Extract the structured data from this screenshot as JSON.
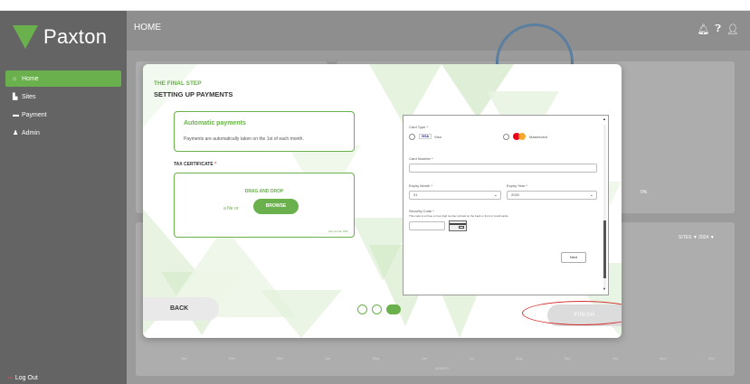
{
  "app": {
    "logo_text": "Paxton",
    "header_title": "HOME"
  },
  "sidebar": {
    "items": [
      {
        "label": "Home",
        "icon": "home-icon",
        "active": true
      },
      {
        "label": "Sites",
        "icon": "sites-icon",
        "active": false
      },
      {
        "label": "Payment",
        "icon": "payment-icon",
        "active": false
      },
      {
        "label": "Admin",
        "icon": "admin-icon",
        "active": false
      }
    ],
    "logout_label": "Log Out"
  },
  "dashboard": {
    "count": "0",
    "percent": "0%",
    "filters": "SITES ▼  2024 ▼",
    "months": [
      "Jan",
      "Feb",
      "Mar",
      "Apr",
      "May",
      "Jun",
      "Jul",
      "Aug",
      "Sep",
      "Oct",
      "Nov",
      "Dec"
    ],
    "axis_title": "MONTH"
  },
  "modal": {
    "step_label": "THE FINAL STEP",
    "step_title": "SETTING UP PAYMENTS",
    "auto_title": "Automatic payments",
    "auto_desc": "Payments are automatically taken on the 1st of each month.",
    "tax_label": "TAX CERTIFICATE",
    "tax_required": "*",
    "drop_title": "DRAG AND DROP",
    "drop_or": "a file or",
    "browse_label": "BROWSE",
    "drop_hint": "File format: PDF",
    "back_label": "BACK",
    "finish_label": "FINISH",
    "step_count": 3,
    "current_step": 3
  },
  "payment_form": {
    "card_type_label": "Card Type *",
    "visa_label": "Visa",
    "mastercard_label": "Mastercard",
    "card_number_label": "Card Number *",
    "card_number_value": "",
    "expiry_month_label": "Expiry Month *",
    "expiry_month_value": "01",
    "expiry_year_label": "Expiry Year *",
    "expiry_year_value": "2020",
    "security_code_label": "Security Code *",
    "security_code_hint": "This code is a three or four digit number printed on the back or front of credit cards.",
    "next_label": "Next"
  },
  "colors": {
    "brand_green": "#6ab04c",
    "sidebar_bg": "#646464",
    "header_bg": "#8e8e8e",
    "finish_highlight": "#d32f2f"
  }
}
